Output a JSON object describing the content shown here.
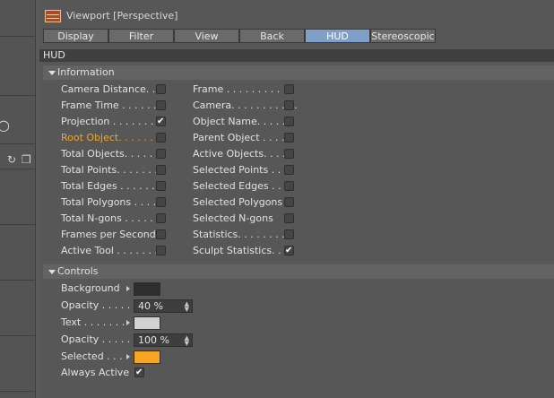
{
  "title": "Viewport [Perspective]",
  "tabs": [
    {
      "label": "Display",
      "active": false
    },
    {
      "label": "Filter",
      "active": false
    },
    {
      "label": "View",
      "active": false
    },
    {
      "label": "Back",
      "active": false
    },
    {
      "label": "HUD",
      "active": true
    },
    {
      "label": "Stereoscopic",
      "active": false
    }
  ],
  "section": "HUD",
  "information": {
    "header": "Information",
    "left": [
      {
        "label": "Camera Distance. .",
        "checked": false,
        "highlight": false
      },
      {
        "label": "Frame Time . . . . . .",
        "checked": false,
        "highlight": false
      },
      {
        "label": "Projection . . . . . . . .",
        "checked": true,
        "highlight": false
      },
      {
        "label": "Root Object. . . . . . .",
        "checked": false,
        "highlight": true
      },
      {
        "label": "Total Objects. . . . . .",
        "checked": false,
        "highlight": false
      },
      {
        "label": "Total Points. . . . . . .",
        "checked": false,
        "highlight": false
      },
      {
        "label": "Total Edges . . . . . . .",
        "checked": false,
        "highlight": false
      },
      {
        "label": "Total Polygons . . . .",
        "checked": false,
        "highlight": false
      },
      {
        "label": "Total N-gons . . . . .",
        "checked": false,
        "highlight": false
      },
      {
        "label": "Frames per Second",
        "checked": false,
        "highlight": false
      },
      {
        "label": "Active Tool . . . . . . .",
        "checked": false,
        "highlight": false
      }
    ],
    "right": [
      {
        "label": "Frame . . . . . . . . . . .",
        "checked": false
      },
      {
        "label": "Camera. . . . . . . . . . .",
        "checked": false
      },
      {
        "label": "Object Name. . . . . .",
        "checked": false
      },
      {
        "label": "Parent Object . . . .",
        "checked": false
      },
      {
        "label": "Active Objects. . . . .",
        "checked": false
      },
      {
        "label": "Selected Points . . .",
        "checked": false
      },
      {
        "label": "Selected Edges . . .",
        "checked": false
      },
      {
        "label": "Selected Polygons",
        "checked": false
      },
      {
        "label": "Selected N-gons",
        "checked": false
      },
      {
        "label": "Statistics. . . . . . . . .",
        "checked": false
      },
      {
        "label": "Sculpt Statistics. . .",
        "checked": true
      }
    ]
  },
  "controls": {
    "header": "Controls",
    "background_label": "Background",
    "background_color": "#2e2e2e",
    "opacity1_label": "Opacity . . . . .",
    "opacity1_value": "40 %",
    "text_label": "Text . . . . . . .",
    "text_color": "#d2d2d2",
    "opacity2_label": "Opacity . . . . .",
    "opacity2_value": "100 %",
    "selected_label": "Selected . . .",
    "selected_color": "#f5a623",
    "always_active_label": "Always Active",
    "always_active_checked": true
  }
}
